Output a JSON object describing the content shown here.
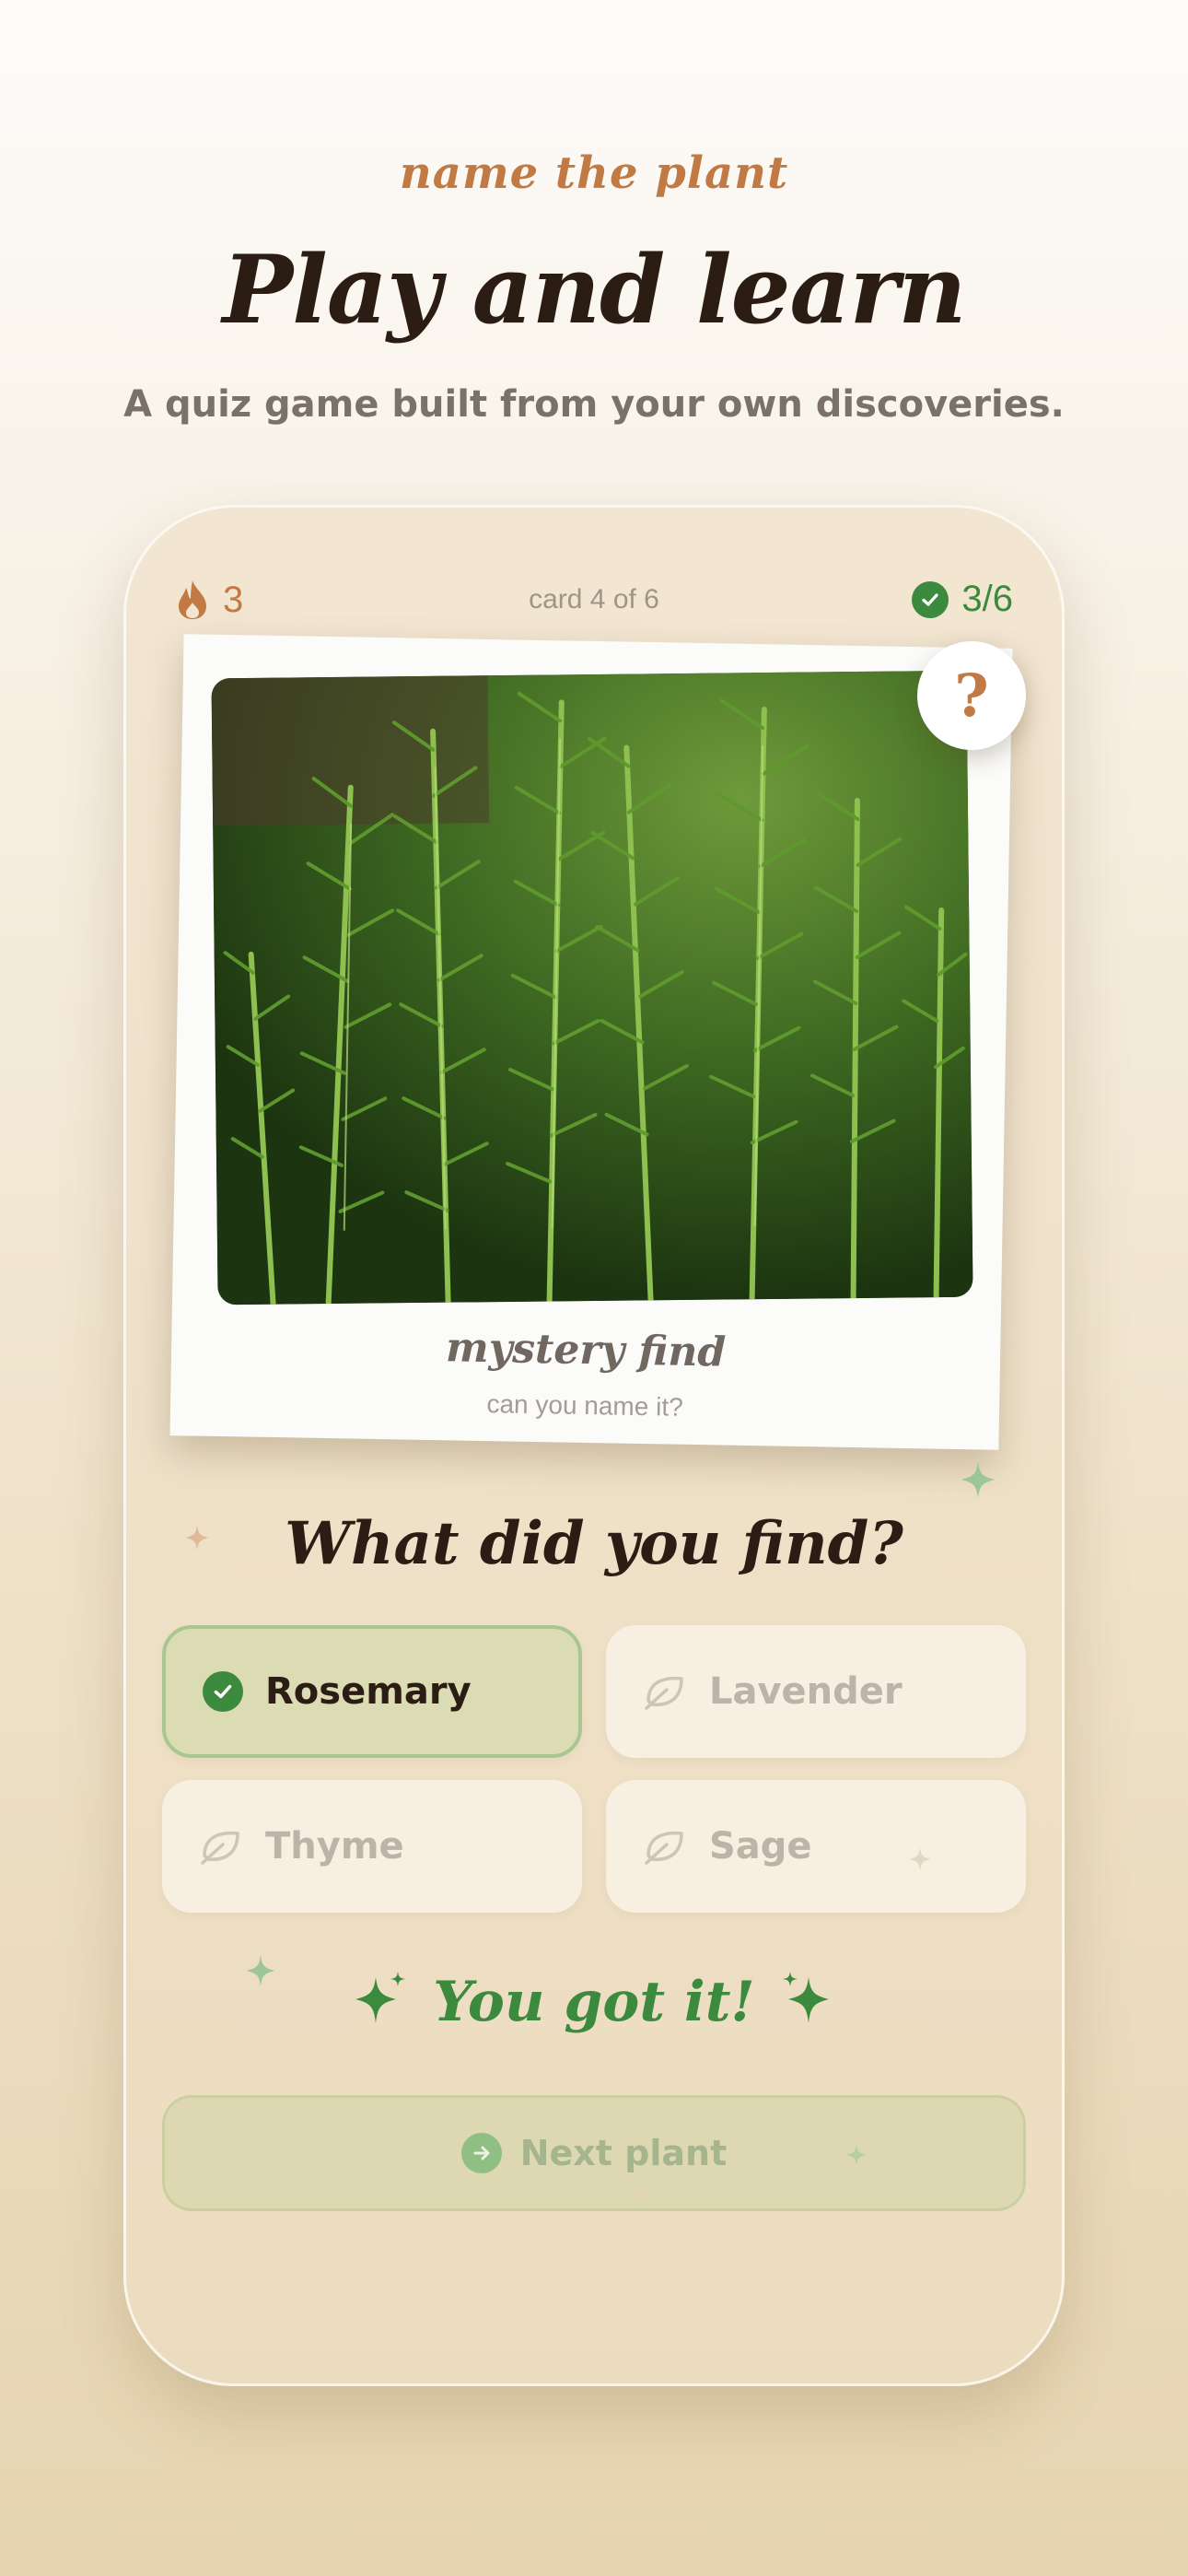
{
  "header": {
    "kicker": "name the plant",
    "title": "Play and learn",
    "subtitle": "A quiz game built from your own discoveries."
  },
  "status": {
    "streak": "3",
    "card_counter": "card 4 of 6",
    "score": "3/6"
  },
  "photo_card": {
    "label": "mystery find",
    "sublabel": "can you name it?",
    "help_badge": "?",
    "image_subject": "rosemary plant"
  },
  "question": "What did you find?",
  "options": [
    {
      "label": "Rosemary",
      "state": "correct",
      "icon": "check-icon"
    },
    {
      "label": "Lavender",
      "state": "disabled",
      "icon": "leaf-icon"
    },
    {
      "label": "Thyme",
      "state": "disabled",
      "icon": "leaf-icon"
    },
    {
      "label": "Sage",
      "state": "disabled",
      "icon": "leaf-icon"
    }
  ],
  "feedback": "You got it!",
  "next_button": {
    "label": "Next plant",
    "icon": "arrow-right-icon"
  },
  "colors": {
    "accent_orange": "#c27a45",
    "success_green": "#3c8a3e",
    "title_dark": "#2c1d14"
  }
}
